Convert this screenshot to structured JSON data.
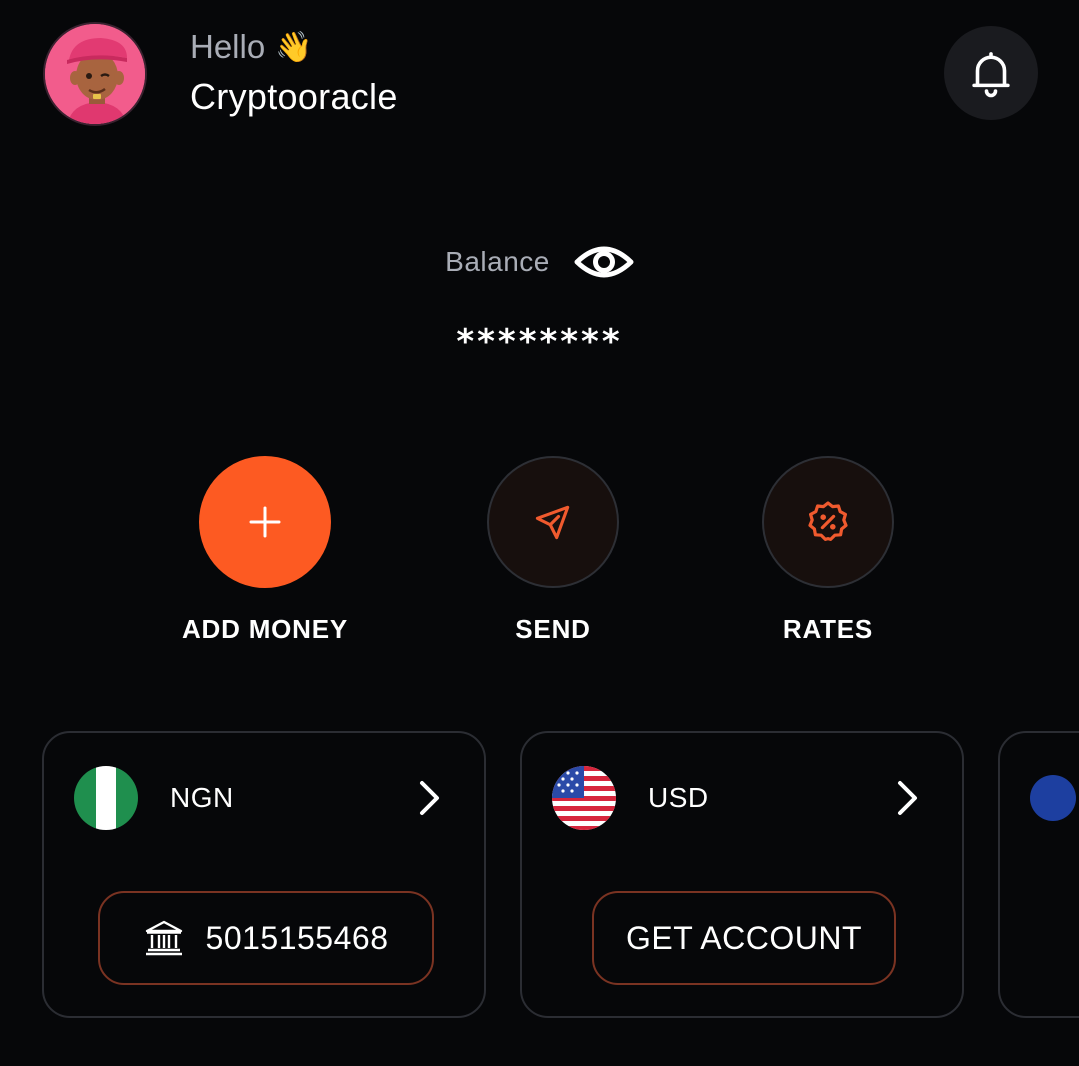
{
  "header": {
    "greeting": "Hello",
    "wave_emoji": "👋",
    "username": "Cryptooracle",
    "avatar_icon": "avatar-3d-character",
    "notification_icon": "bell-icon"
  },
  "balance": {
    "label": "Balance",
    "value": "********",
    "visibility_icon": "eye-icon"
  },
  "actions": [
    {
      "label": "ADD MONEY",
      "icon": "plus-icon"
    },
    {
      "label": "SEND",
      "icon": "send-icon"
    },
    {
      "label": "RATES",
      "icon": "rates-badge-icon"
    }
  ],
  "accounts": [
    {
      "currency": "NGN",
      "flag": "nigeria-flag",
      "account_number": "5015155468",
      "button_icon": "bank-icon"
    },
    {
      "currency": "USD",
      "flag": "us-flag",
      "button_label": "GET ACCOUNT"
    }
  ],
  "colors": {
    "accent": "#fd5a22",
    "background": "#060709",
    "card_border": "#2b2d33",
    "button_border": "#7a3322"
  }
}
